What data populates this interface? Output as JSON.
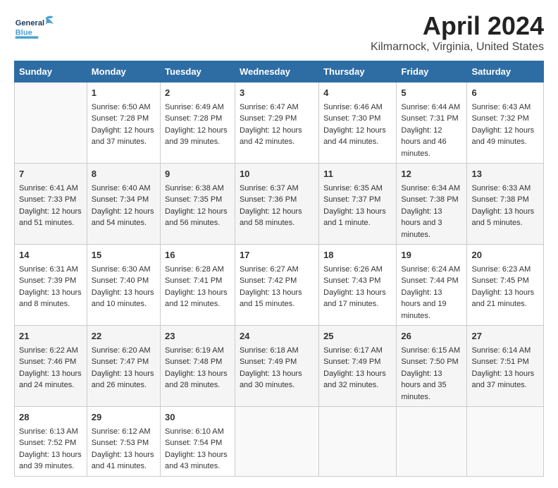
{
  "header": {
    "logo_general": "General",
    "logo_blue": "Blue",
    "title": "April 2024",
    "subtitle": "Kilmarnock, Virginia, United States"
  },
  "days_of_week": [
    "Sunday",
    "Monday",
    "Tuesday",
    "Wednesday",
    "Thursday",
    "Friday",
    "Saturday"
  ],
  "weeks": [
    [
      {
        "day": "",
        "sunrise": "",
        "sunset": "",
        "daylight": ""
      },
      {
        "day": "1",
        "sunrise": "Sunrise: 6:50 AM",
        "sunset": "Sunset: 7:28 PM",
        "daylight": "Daylight: 12 hours and 37 minutes."
      },
      {
        "day": "2",
        "sunrise": "Sunrise: 6:49 AM",
        "sunset": "Sunset: 7:28 PM",
        "daylight": "Daylight: 12 hours and 39 minutes."
      },
      {
        "day": "3",
        "sunrise": "Sunrise: 6:47 AM",
        "sunset": "Sunset: 7:29 PM",
        "daylight": "Daylight: 12 hours and 42 minutes."
      },
      {
        "day": "4",
        "sunrise": "Sunrise: 6:46 AM",
        "sunset": "Sunset: 7:30 PM",
        "daylight": "Daylight: 12 hours and 44 minutes."
      },
      {
        "day": "5",
        "sunrise": "Sunrise: 6:44 AM",
        "sunset": "Sunset: 7:31 PM",
        "daylight": "Daylight: 12 hours and 46 minutes."
      },
      {
        "day": "6",
        "sunrise": "Sunrise: 6:43 AM",
        "sunset": "Sunset: 7:32 PM",
        "daylight": "Daylight: 12 hours and 49 minutes."
      }
    ],
    [
      {
        "day": "7",
        "sunrise": "Sunrise: 6:41 AM",
        "sunset": "Sunset: 7:33 PM",
        "daylight": "Daylight: 12 hours and 51 minutes."
      },
      {
        "day": "8",
        "sunrise": "Sunrise: 6:40 AM",
        "sunset": "Sunset: 7:34 PM",
        "daylight": "Daylight: 12 hours and 54 minutes."
      },
      {
        "day": "9",
        "sunrise": "Sunrise: 6:38 AM",
        "sunset": "Sunset: 7:35 PM",
        "daylight": "Daylight: 12 hours and 56 minutes."
      },
      {
        "day": "10",
        "sunrise": "Sunrise: 6:37 AM",
        "sunset": "Sunset: 7:36 PM",
        "daylight": "Daylight: 12 hours and 58 minutes."
      },
      {
        "day": "11",
        "sunrise": "Sunrise: 6:35 AM",
        "sunset": "Sunset: 7:37 PM",
        "daylight": "Daylight: 13 hours and 1 minute."
      },
      {
        "day": "12",
        "sunrise": "Sunrise: 6:34 AM",
        "sunset": "Sunset: 7:38 PM",
        "daylight": "Daylight: 13 hours and 3 minutes."
      },
      {
        "day": "13",
        "sunrise": "Sunrise: 6:33 AM",
        "sunset": "Sunset: 7:38 PM",
        "daylight": "Daylight: 13 hours and 5 minutes."
      }
    ],
    [
      {
        "day": "14",
        "sunrise": "Sunrise: 6:31 AM",
        "sunset": "Sunset: 7:39 PM",
        "daylight": "Daylight: 13 hours and 8 minutes."
      },
      {
        "day": "15",
        "sunrise": "Sunrise: 6:30 AM",
        "sunset": "Sunset: 7:40 PM",
        "daylight": "Daylight: 13 hours and 10 minutes."
      },
      {
        "day": "16",
        "sunrise": "Sunrise: 6:28 AM",
        "sunset": "Sunset: 7:41 PM",
        "daylight": "Daylight: 13 hours and 12 minutes."
      },
      {
        "day": "17",
        "sunrise": "Sunrise: 6:27 AM",
        "sunset": "Sunset: 7:42 PM",
        "daylight": "Daylight: 13 hours and 15 minutes."
      },
      {
        "day": "18",
        "sunrise": "Sunrise: 6:26 AM",
        "sunset": "Sunset: 7:43 PM",
        "daylight": "Daylight: 13 hours and 17 minutes."
      },
      {
        "day": "19",
        "sunrise": "Sunrise: 6:24 AM",
        "sunset": "Sunset: 7:44 PM",
        "daylight": "Daylight: 13 hours and 19 minutes."
      },
      {
        "day": "20",
        "sunrise": "Sunrise: 6:23 AM",
        "sunset": "Sunset: 7:45 PM",
        "daylight": "Daylight: 13 hours and 21 minutes."
      }
    ],
    [
      {
        "day": "21",
        "sunrise": "Sunrise: 6:22 AM",
        "sunset": "Sunset: 7:46 PM",
        "daylight": "Daylight: 13 hours and 24 minutes."
      },
      {
        "day": "22",
        "sunrise": "Sunrise: 6:20 AM",
        "sunset": "Sunset: 7:47 PM",
        "daylight": "Daylight: 13 hours and 26 minutes."
      },
      {
        "day": "23",
        "sunrise": "Sunrise: 6:19 AM",
        "sunset": "Sunset: 7:48 PM",
        "daylight": "Daylight: 13 hours and 28 minutes."
      },
      {
        "day": "24",
        "sunrise": "Sunrise: 6:18 AM",
        "sunset": "Sunset: 7:49 PM",
        "daylight": "Daylight: 13 hours and 30 minutes."
      },
      {
        "day": "25",
        "sunrise": "Sunrise: 6:17 AM",
        "sunset": "Sunset: 7:49 PM",
        "daylight": "Daylight: 13 hours and 32 minutes."
      },
      {
        "day": "26",
        "sunrise": "Sunrise: 6:15 AM",
        "sunset": "Sunset: 7:50 PM",
        "daylight": "Daylight: 13 hours and 35 minutes."
      },
      {
        "day": "27",
        "sunrise": "Sunrise: 6:14 AM",
        "sunset": "Sunset: 7:51 PM",
        "daylight": "Daylight: 13 hours and 37 minutes."
      }
    ],
    [
      {
        "day": "28",
        "sunrise": "Sunrise: 6:13 AM",
        "sunset": "Sunset: 7:52 PM",
        "daylight": "Daylight: 13 hours and 39 minutes."
      },
      {
        "day": "29",
        "sunrise": "Sunrise: 6:12 AM",
        "sunset": "Sunset: 7:53 PM",
        "daylight": "Daylight: 13 hours and 41 minutes."
      },
      {
        "day": "30",
        "sunrise": "Sunrise: 6:10 AM",
        "sunset": "Sunset: 7:54 PM",
        "daylight": "Daylight: 13 hours and 43 minutes."
      },
      {
        "day": "",
        "sunrise": "",
        "sunset": "",
        "daylight": ""
      },
      {
        "day": "",
        "sunrise": "",
        "sunset": "",
        "daylight": ""
      },
      {
        "day": "",
        "sunrise": "",
        "sunset": "",
        "daylight": ""
      },
      {
        "day": "",
        "sunrise": "",
        "sunset": "",
        "daylight": ""
      }
    ]
  ]
}
